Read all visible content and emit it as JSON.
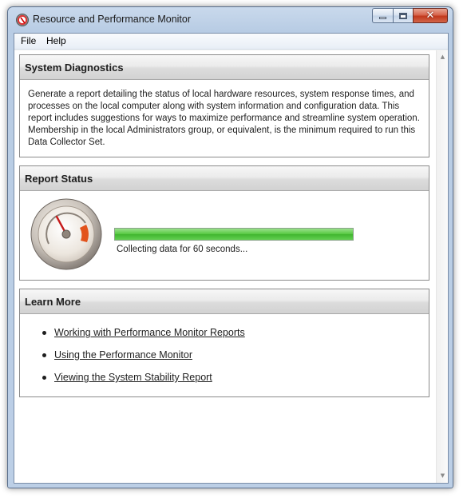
{
  "window": {
    "title": "Resource and Performance Monitor",
    "icon": "performance-monitor-icon",
    "caption_buttons": [
      "minimize",
      "maximize",
      "close"
    ]
  },
  "menu": {
    "items": [
      "File",
      "Help"
    ]
  },
  "diagnostics": {
    "title": "System Diagnostics",
    "description": "Generate a report detailing the status of local hardware resources, system response times, and processes on the local computer along with system information and configuration data. This report includes suggestions for ways to maximize performance and streamline system operation. Membership in the local Administrators group, or equivalent, is the minimum required to run this Data Collector Set."
  },
  "report_status": {
    "title": "Report Status",
    "gauge_icon": "performance-gauge-icon",
    "progress_fraction": 1.0,
    "progress_text": "Collecting data for 60 seconds...",
    "progress_color": "#4cc23a"
  },
  "learn_more": {
    "title": "Learn More",
    "links": [
      "Working with Performance Monitor Reports",
      "Using the Performance Monitor",
      "Viewing the System Stability Report"
    ]
  }
}
